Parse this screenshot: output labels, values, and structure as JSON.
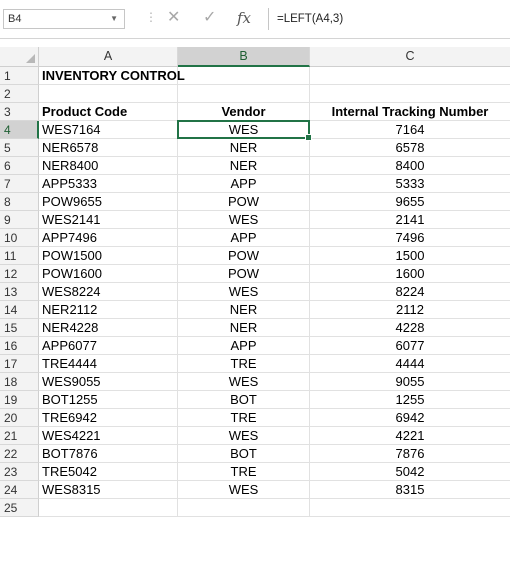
{
  "formula_bar": {
    "name_box": "B4",
    "cancel_icon": "✕",
    "enter_icon": "✓",
    "fx_label": "fx",
    "formula": "=LEFT(A4,3)"
  },
  "columns": [
    "A",
    "B",
    "C"
  ],
  "selected_cell": "B4",
  "rows": [
    {
      "n": "1",
      "a": "INVENTORY CONTROL",
      "b": "",
      "c": ""
    },
    {
      "n": "2",
      "a": "",
      "b": "",
      "c": ""
    },
    {
      "n": "3",
      "a": "Product Code",
      "b": "Vendor",
      "c": "Internal Tracking Number"
    },
    {
      "n": "4",
      "a": "WES7164",
      "b": "WES",
      "c": "7164"
    },
    {
      "n": "5",
      "a": "NER6578",
      "b": "NER",
      "c": "6578"
    },
    {
      "n": "6",
      "a": "NER8400",
      "b": "NER",
      "c": "8400"
    },
    {
      "n": "7",
      "a": "APP5333",
      "b": "APP",
      "c": "5333"
    },
    {
      "n": "8",
      "a": "POW9655",
      "b": "POW",
      "c": "9655"
    },
    {
      "n": "9",
      "a": "WES2141",
      "b": "WES",
      "c": "2141"
    },
    {
      "n": "10",
      "a": "APP7496",
      "b": "APP",
      "c": "7496"
    },
    {
      "n": "11",
      "a": "POW1500",
      "b": "POW",
      "c": "1500"
    },
    {
      "n": "12",
      "a": "POW1600",
      "b": "POW",
      "c": "1600"
    },
    {
      "n": "13",
      "a": "WES8224",
      "b": "WES",
      "c": "8224"
    },
    {
      "n": "14",
      "a": "NER2112",
      "b": "NER",
      "c": "2112"
    },
    {
      "n": "15",
      "a": "NER4228",
      "b": "NER",
      "c": "4228"
    },
    {
      "n": "16",
      "a": "APP6077",
      "b": "APP",
      "c": "6077"
    },
    {
      "n": "17",
      "a": "TRE4444",
      "b": "TRE",
      "c": "4444"
    },
    {
      "n": "18",
      "a": "WES9055",
      "b": "WES",
      "c": "9055"
    },
    {
      "n": "19",
      "a": "BOT1255",
      "b": "BOT",
      "c": "1255"
    },
    {
      "n": "20",
      "a": "TRE6942",
      "b": "TRE",
      "c": "6942"
    },
    {
      "n": "21",
      "a": "WES4221",
      "b": "WES",
      "c": "4221"
    },
    {
      "n": "22",
      "a": "BOT7876",
      "b": "BOT",
      "c": "7876"
    },
    {
      "n": "23",
      "a": "TRE5042",
      "b": "TRE",
      "c": "5042"
    },
    {
      "n": "24",
      "a": "WES8315",
      "b": "WES",
      "c": "8315"
    },
    {
      "n": "25",
      "a": "",
      "b": "",
      "c": ""
    }
  ]
}
